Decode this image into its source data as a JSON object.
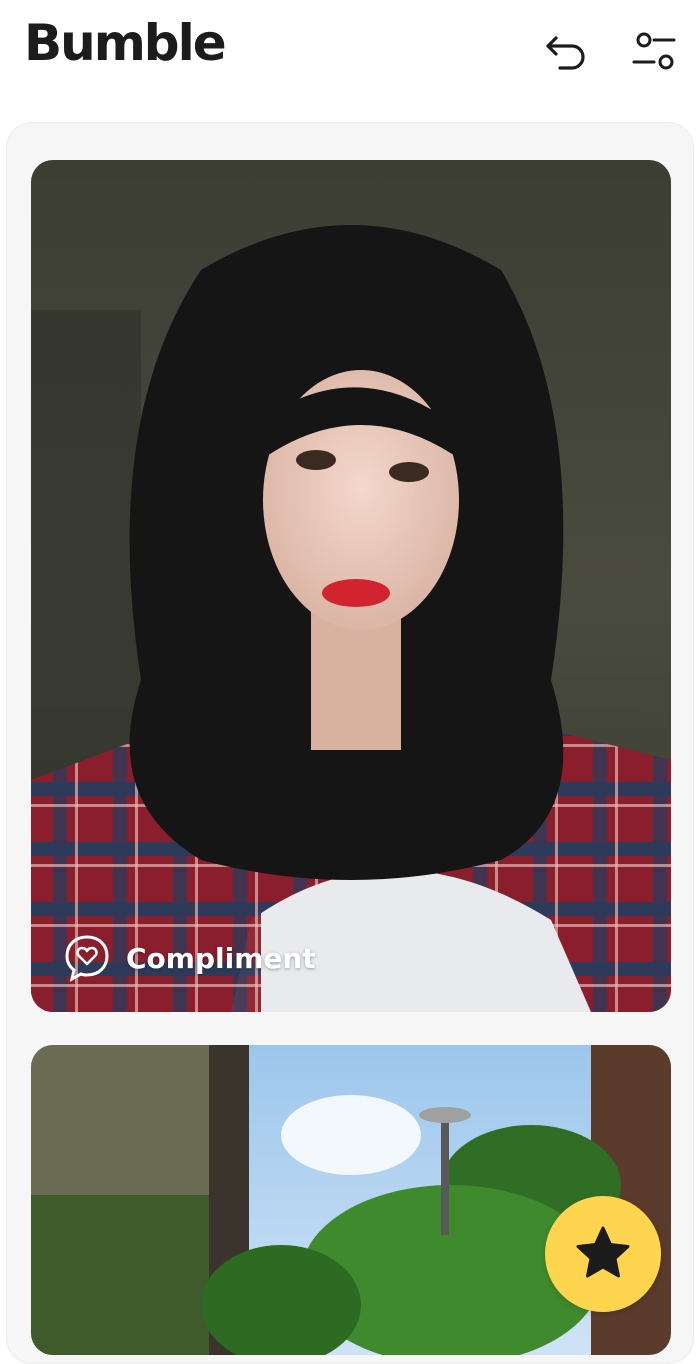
{
  "header": {
    "brand": "Bumble",
    "undo_icon": "undo-arrow-icon",
    "filters_icon": "filters-toggle-icon"
  },
  "profile": {
    "compliment_label": "Compliment",
    "compliment_icon": "heart-chat-icon"
  },
  "actions": {
    "superswipe_icon": "star-icon"
  },
  "colors": {
    "brand_text": "#1c1c1c",
    "accent_yellow": "#ffd54f",
    "feed_bg": "#f6f6f6"
  }
}
